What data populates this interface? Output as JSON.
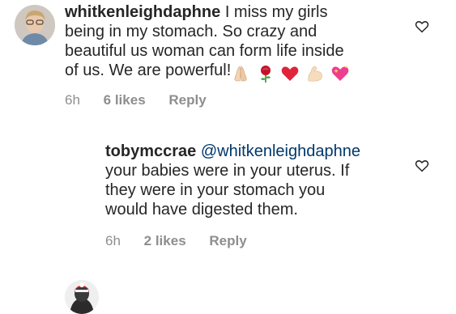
{
  "comments": [
    {
      "username": "whitkenleighdaphne",
      "text_lines": [
        "I miss my girls",
        "being in my stomach. So crazy and",
        "beautiful us woman can form life inside",
        "of us. We are powerful!"
      ],
      "emojis": [
        "folded-hands-icon",
        "rose-icon",
        "red-heart-icon",
        "flexed-biceps-icon",
        "sparkling-heart-icon"
      ],
      "time": "6h",
      "likes": "6 likes",
      "reply_label": "Reply"
    },
    {
      "username": "tobymccrae",
      "mention": "@whitkenleighdaphne",
      "text_lines": [
        "your babies were in your uterus. If",
        "they were in your stomach you",
        "would have digested them."
      ],
      "time": "6h",
      "likes": "2 likes",
      "reply_label": "Reply"
    }
  ],
  "colors": {
    "text": "#262626",
    "secondary": "#8e8e8e",
    "mention": "#00376b",
    "background": "#ffffff"
  }
}
